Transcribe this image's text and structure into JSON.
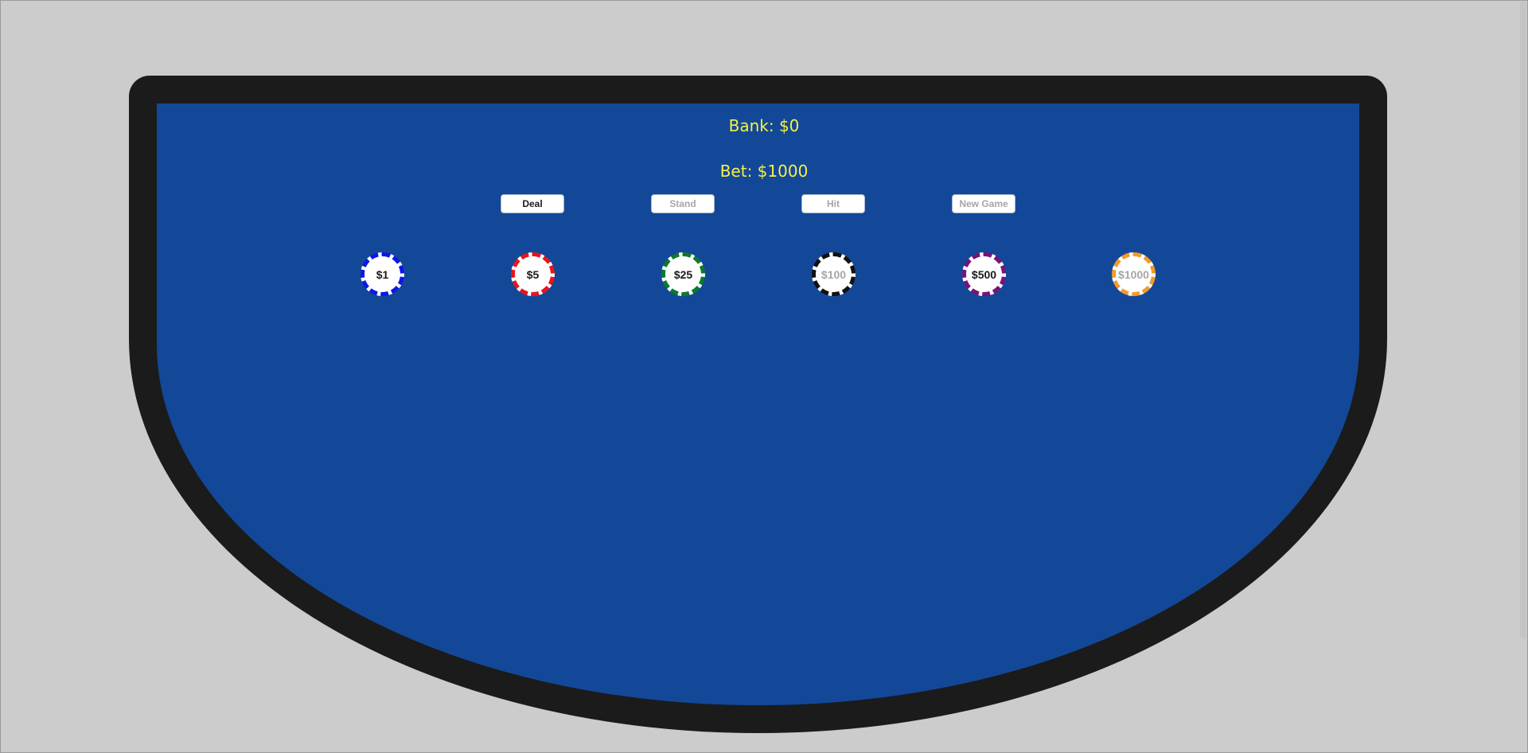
{
  "info": {
    "bank_text": "Bank: $0",
    "bet_text": "Bet: $1000"
  },
  "buttons": [
    {
      "label": "Deal",
      "enabled": true
    },
    {
      "label": "Stand",
      "enabled": false
    },
    {
      "label": "Hit",
      "enabled": false
    },
    {
      "label": "New Game",
      "enabled": false
    }
  ],
  "chips": [
    {
      "label": "$1",
      "color": "#0a18e8",
      "enabled": true
    },
    {
      "label": "$5",
      "color": "#e8141c",
      "enabled": true
    },
    {
      "label": "$25",
      "color": "#0a7a2a",
      "enabled": true
    },
    {
      "label": "$100",
      "color": "#111111",
      "enabled": false
    },
    {
      "label": "$500",
      "color": "#7a127a",
      "enabled": true
    },
    {
      "label": "$1000",
      "color": "#f49a2a",
      "enabled": false
    }
  ],
  "colors": {
    "felt": "#134898",
    "rail": "#1b1b1b",
    "info_text": "#f7f146",
    "background": "#cccccc"
  }
}
